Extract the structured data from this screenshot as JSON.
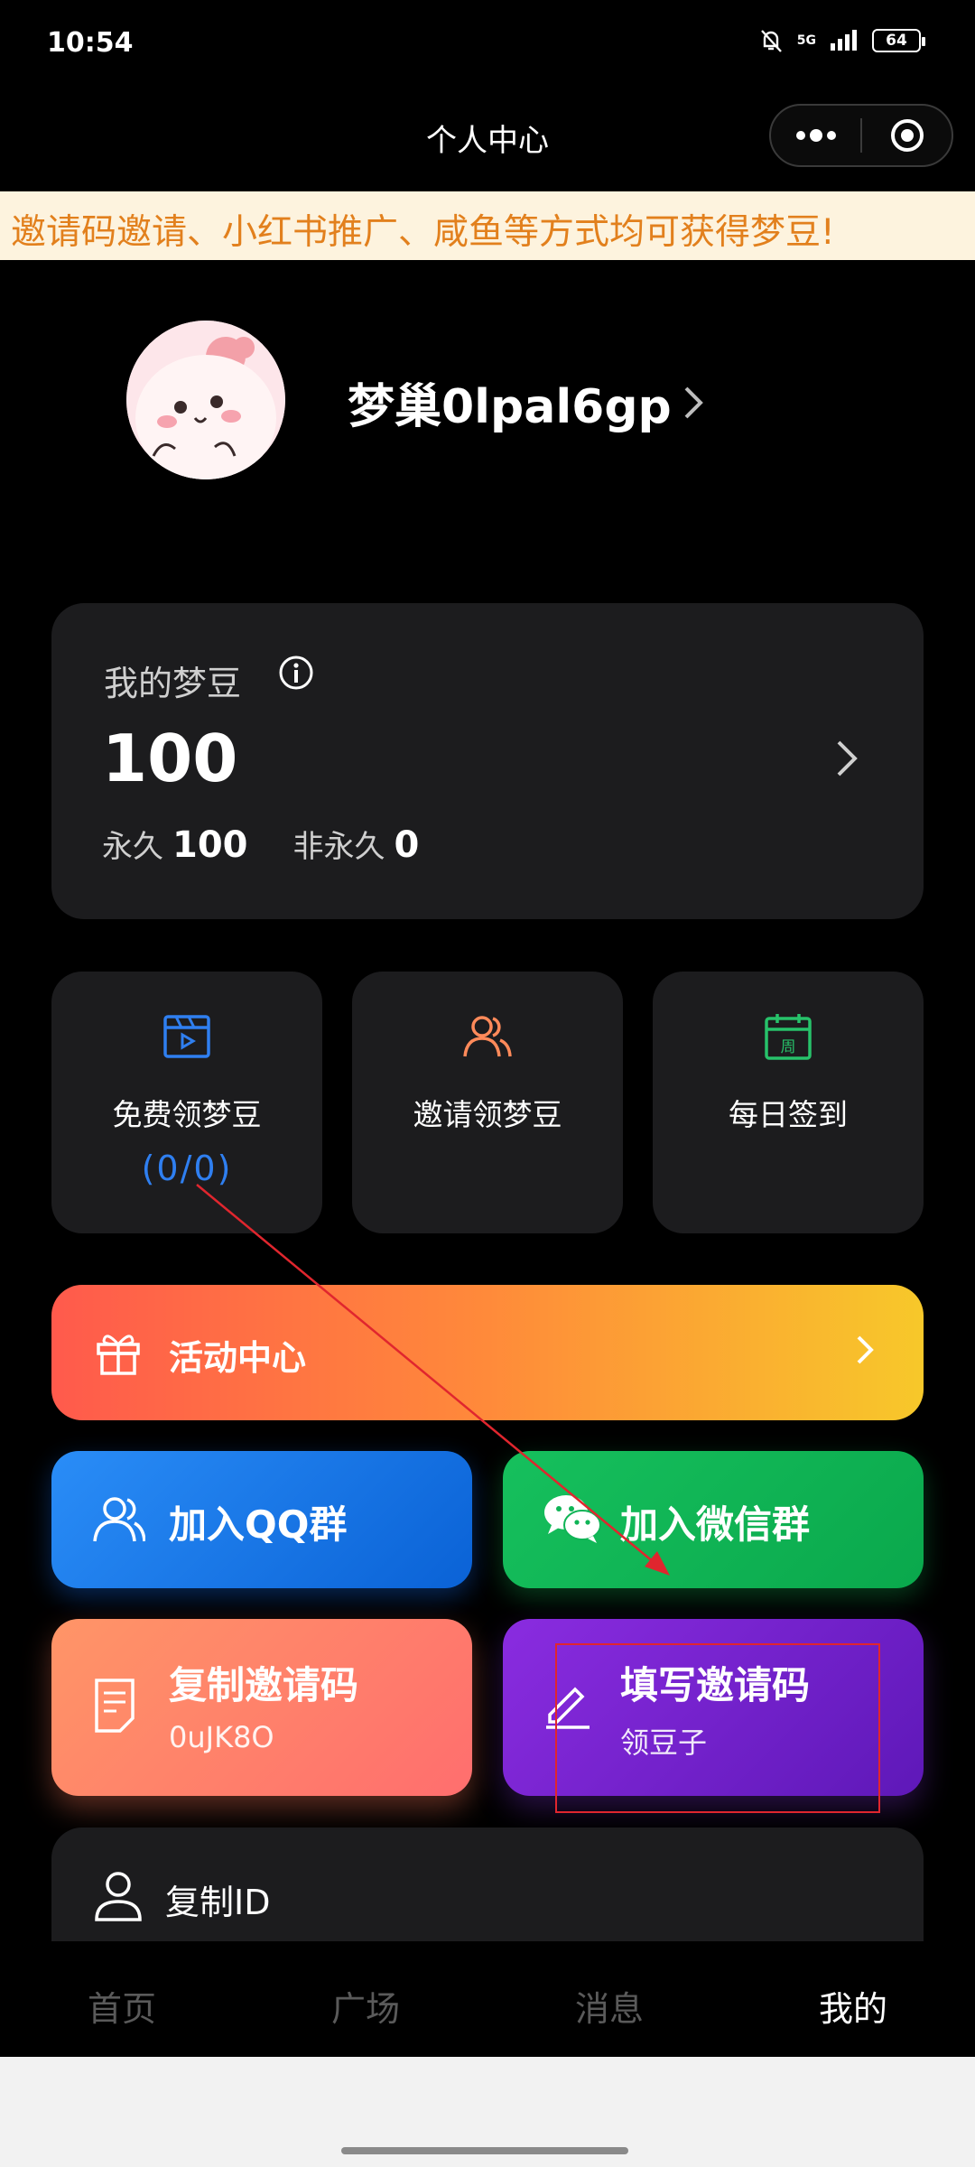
{
  "status_bar": {
    "time": "10:54",
    "network": "5G",
    "battery": "64"
  },
  "header": {
    "title": "个人中心"
  },
  "notice": {
    "text": "邀请码邀请、小红书推广、咸鱼等方式均可获得梦豆!"
  },
  "profile": {
    "username": "梦巢0lpal6gp"
  },
  "beans": {
    "title": "我的梦豆",
    "total": "100",
    "permanent_label": "永久",
    "permanent_value": "100",
    "nonpermanent_label": "非永久",
    "nonpermanent_value": "0"
  },
  "quick_actions": [
    {
      "label": "免费领梦豆",
      "count": "(0/0)",
      "icon": "video-icon",
      "color": "#2f7ff0"
    },
    {
      "label": "邀请领梦豆",
      "icon": "users-icon",
      "color": "#ff8a5a"
    },
    {
      "label": "每日签到",
      "icon": "calendar-icon",
      "icon_text": "周",
      "color": "#27c26a"
    }
  ],
  "activity": {
    "label": "活动中心"
  },
  "tiles": {
    "qq": {
      "label": "加入QQ群"
    },
    "wechat": {
      "label": "加入微信群"
    },
    "copy_invite": {
      "label": "复制邀请码",
      "code": "0uJK8O"
    },
    "fill_invite": {
      "label": "填写邀请码",
      "sub": "领豆子"
    }
  },
  "copy_id": {
    "label": "复制ID"
  },
  "tabbar": {
    "tabs": [
      "首页",
      "广场",
      "消息",
      "我的"
    ],
    "active": 3
  },
  "colors": {
    "annotation": "#e0262e",
    "notice_text": "#e2801d"
  }
}
